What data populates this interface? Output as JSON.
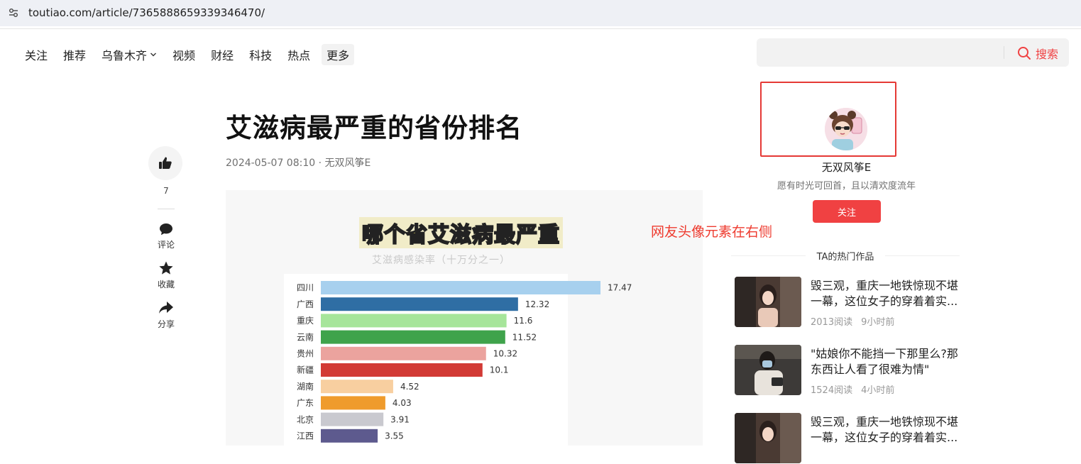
{
  "browser": {
    "url": "toutiao.com/article/7365888659339346470/"
  },
  "nav": {
    "items": [
      "关注",
      "推荐",
      "乌鲁木齐",
      "视频",
      "财经",
      "科技",
      "热点"
    ],
    "more": "更多"
  },
  "search": {
    "placeholder": "",
    "button_label": "搜索"
  },
  "article": {
    "title": "艾滋病最严重的省份排名",
    "meta": "2024-05-07 08:10 · 无双风筝E",
    "like_count": "7",
    "actions": {
      "comment": "评论",
      "favorite": "收藏",
      "share": "分享"
    }
  },
  "annotation": "网友头像元素在右侧",
  "author": {
    "name": "无双风筝E",
    "signature": "愿有时光可回首，且以清欢度流年",
    "follow_label": "关注"
  },
  "hot": {
    "heading": "TA的热门作品",
    "items": [
      {
        "title": "毁三观，重庆一地铁惊现不堪一幕，这位女子的穿着着实...",
        "reads": "2013阅读",
        "time": "9小时前"
      },
      {
        "title": "\"姑娘你不能挡一下那里么?那东西让人看了很难为情\"",
        "reads": "1524阅读",
        "time": "4小时前"
      },
      {
        "title": "毁三观，重庆一地铁惊现不堪一幕，这位女子的穿着着实...",
        "reads": "",
        "time": ""
      }
    ]
  },
  "chart_data": {
    "type": "bar",
    "title": "哪个省艾滋病最严重",
    "subtitle": "艾滋病感染率（十万分之一）",
    "categories": [
      "四川",
      "广西",
      "重庆",
      "云南",
      "贵州",
      "新疆",
      "湖南",
      "广东",
      "北京",
      "江西"
    ],
    "values": [
      17.47,
      12.32,
      11.6,
      11.52,
      10.32,
      10.1,
      4.52,
      4.03,
      3.91,
      3.55
    ],
    "value_labels": [
      "17.47",
      "12.32",
      "11.6",
      "11.52",
      "10.32",
      "10.1",
      "4.52",
      "4.03",
      "3.91",
      "3.55"
    ],
    "colors": [
      "#a7d0ee",
      "#2f6ea4",
      "#a6e59a",
      "#3fa34b",
      "#eba39e",
      "#d23a35",
      "#f8cfa0",
      "#ef9b2c",
      "#c9c9cf",
      "#5d5a8e"
    ],
    "orientation": "horizontal"
  }
}
